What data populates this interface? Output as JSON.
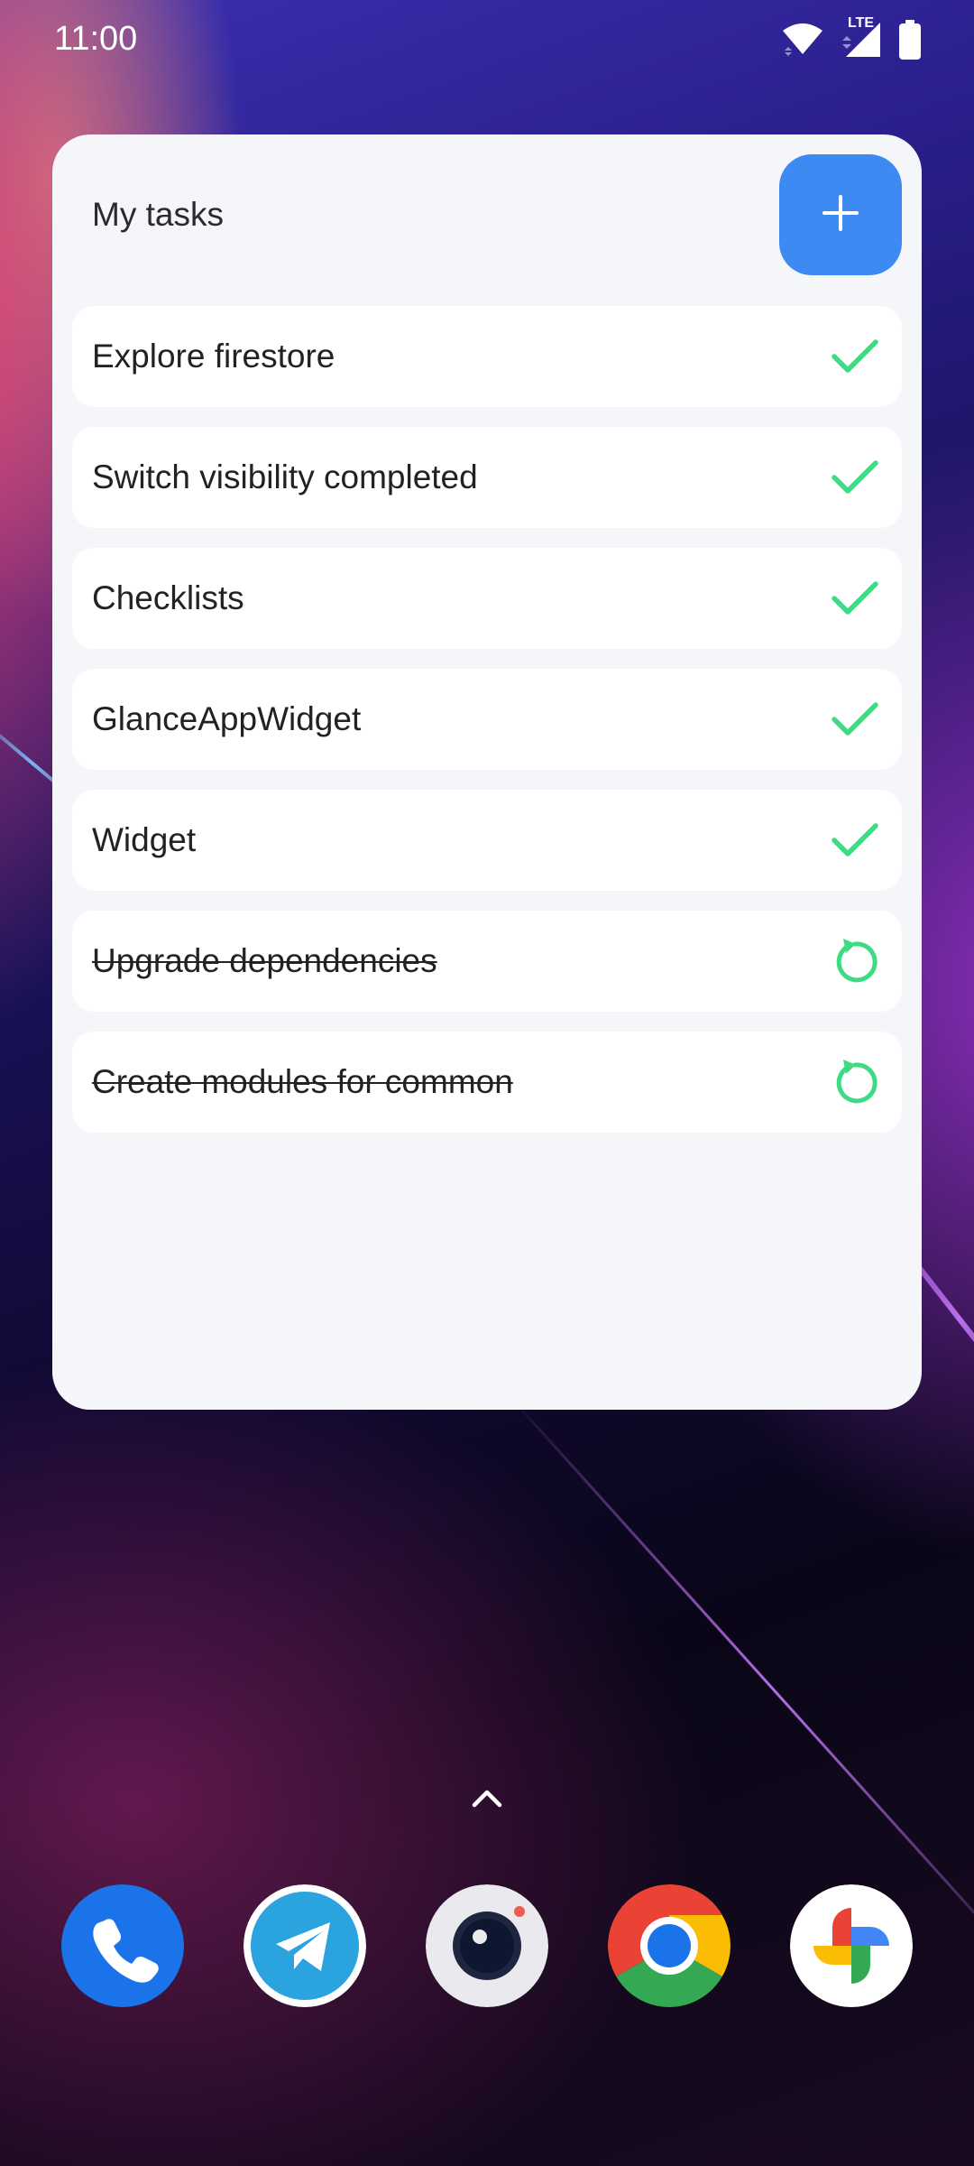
{
  "status_bar": {
    "time": "11:00",
    "network_label": "LTE",
    "icons": [
      "wifi-icon",
      "signal-icon",
      "battery-icon"
    ]
  },
  "widget": {
    "title": "My tasks",
    "add_button_icon": "plus-icon",
    "accent_color": "#3d8bf2",
    "check_color": "#3ddc84",
    "tasks": [
      {
        "label": "Explore firestore",
        "completed": false,
        "action_icon": "check-icon"
      },
      {
        "label": "Switch visibility completed",
        "completed": false,
        "action_icon": "check-icon"
      },
      {
        "label": "Checklists",
        "completed": false,
        "action_icon": "check-icon"
      },
      {
        "label": "GlanceAppWidget",
        "completed": false,
        "action_icon": "check-icon"
      },
      {
        "label": "Widget",
        "completed": false,
        "action_icon": "check-icon"
      },
      {
        "label": "Upgrade dependencies",
        "completed": true,
        "action_icon": "restore-icon"
      },
      {
        "label": "Create modules for common",
        "completed": true,
        "action_icon": "restore-icon"
      }
    ]
  },
  "home": {
    "drawer_handle_icon": "chevron-up-icon",
    "dock_apps": [
      "phone-icon",
      "telegram-icon",
      "camera-icon",
      "chrome-icon",
      "photos-icon"
    ]
  }
}
